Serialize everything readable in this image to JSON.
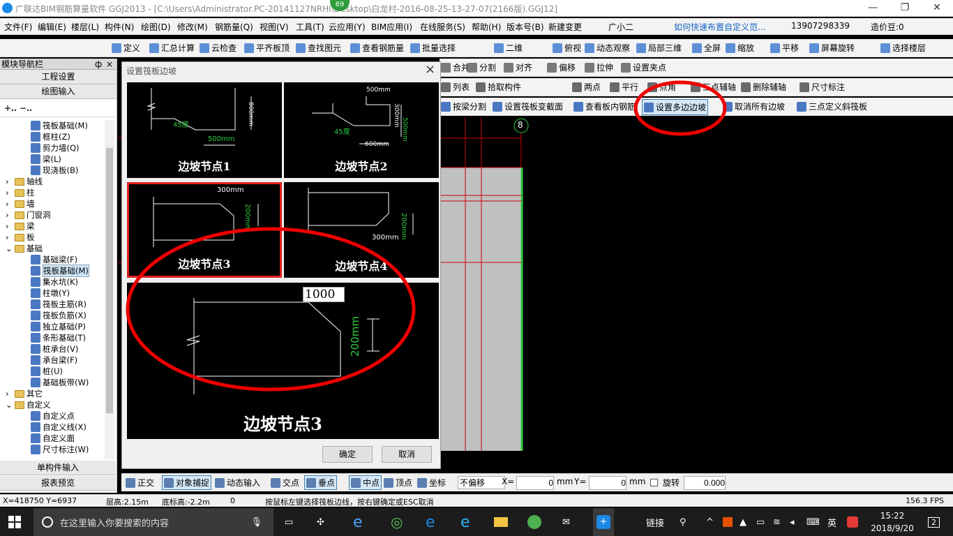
{
  "window": {
    "title": "广联达BIM钢筋算量软件 GGJ2013 - [C:\\Users\\Administrator.PC-20141127NRHI\\Desktop\\白龙村-2016-08-25-13-27-07(2166版).GGJ12]",
    "badge": "69"
  },
  "menu": [
    "文件(F)",
    "编辑(E)",
    "楼层(L)",
    "构件(N)",
    "绘图(D)",
    "修改(M)",
    "钢筋量(Q)",
    "视图(V)",
    "工具(T)",
    "云应用(Y)",
    "BIM应用(I)",
    "在线服务(S)",
    "帮助(H)",
    "版本号(B)",
    "新建变更",
    "广小二",
    "如何快速布置自定义范...",
    "13907298339",
    "造价豆:0"
  ],
  "toolbar1": [
    "定义",
    "汇总计算",
    "云检查",
    "平齐板顶",
    "查找图元",
    "查看钢筋量",
    "批量选择",
    "二维",
    "俯视",
    "动态观察",
    "局部三维",
    "全屏",
    "缩放",
    "平移",
    "屏幕旋转",
    "选择楼层"
  ],
  "toolbar2": [
    "合并",
    "分割",
    "对齐",
    "偏移",
    "拉伸",
    "设置夹点"
  ],
  "toolbar3": [
    "列表",
    "拾取构件",
    "两点",
    "平行",
    "点角",
    "三点辅轴",
    "删除辅轴",
    "尺寸标注"
  ],
  "toolbar4": [
    "按梁分割",
    "设置筏板变截面",
    "查看板内钢筋",
    "设置多边边坡",
    "取消所有边坡",
    "三点定义斜筏板"
  ],
  "nav": {
    "title": "模块导航栏",
    "pin": "ф",
    "close": "×",
    "buttons": [
      "工程设置",
      "绘图输入"
    ],
    "tree": [
      {
        "label": "筏板基础(M)",
        "indent": 2,
        "icon": "item"
      },
      {
        "label": "框柱(Z)",
        "indent": 2,
        "icon": "item"
      },
      {
        "label": "剪力墙(Q)",
        "indent": 2,
        "icon": "item"
      },
      {
        "label": "梁(L)",
        "indent": 2,
        "icon": "item"
      },
      {
        "label": "现浇板(B)",
        "indent": 2,
        "icon": "item"
      },
      {
        "label": "轴线",
        "indent": 1,
        "icon": "folder"
      },
      {
        "label": "柱",
        "indent": 1,
        "icon": "folder"
      },
      {
        "label": "墙",
        "indent": 1,
        "icon": "folder"
      },
      {
        "label": "门窗洞",
        "indent": 1,
        "icon": "folder"
      },
      {
        "label": "梁",
        "indent": 1,
        "icon": "folder"
      },
      {
        "label": "板",
        "indent": 1,
        "icon": "folder"
      },
      {
        "label": "基础",
        "indent": 1,
        "icon": "folder-open"
      },
      {
        "label": "基础梁(F)",
        "indent": 2,
        "icon": "item"
      },
      {
        "label": "筏板基础(M)",
        "indent": 2,
        "icon": "item",
        "selected": true
      },
      {
        "label": "集水坑(K)",
        "indent": 2,
        "icon": "item"
      },
      {
        "label": "柱墩(Y)",
        "indent": 2,
        "icon": "item"
      },
      {
        "label": "筏板主筋(R)",
        "indent": 2,
        "icon": "item"
      },
      {
        "label": "筏板负筋(X)",
        "indent": 2,
        "icon": "item"
      },
      {
        "label": "独立基础(P)",
        "indent": 2,
        "icon": "item"
      },
      {
        "label": "条形基础(T)",
        "indent": 2,
        "icon": "item"
      },
      {
        "label": "桩承台(V)",
        "indent": 2,
        "icon": "item"
      },
      {
        "label": "承台梁(F)",
        "indent": 2,
        "icon": "item"
      },
      {
        "label": "桩(U)",
        "indent": 2,
        "icon": "item"
      },
      {
        "label": "基础板带(W)",
        "indent": 2,
        "icon": "item"
      },
      {
        "label": "其它",
        "indent": 1,
        "icon": "folder"
      },
      {
        "label": "自定义",
        "indent": 1,
        "icon": "folder-open"
      },
      {
        "label": "自定义点",
        "indent": 2,
        "icon": "item"
      },
      {
        "label": "自定义线(X)",
        "indent": 2,
        "icon": "item"
      },
      {
        "label": "自定义面",
        "indent": 2,
        "icon": "item"
      },
      {
        "label": "尺寸标注(W)",
        "indent": 2,
        "icon": "item"
      }
    ],
    "bottom": [
      "单构件输入",
      "报表预览"
    ]
  },
  "dialog": {
    "title": "设置筏板边坡",
    "close": "×",
    "nodes": [
      {
        "caption": "边坡节点1",
        "labels": [
          "45度",
          "800mm",
          "500mm"
        ]
      },
      {
        "caption": "边坡节点2",
        "labels": [
          "500mm",
          "300mm",
          "500mm",
          "45度",
          "600mm"
        ]
      },
      {
        "caption": "边坡节点3",
        "labels": [
          "300mm",
          "200mm"
        ]
      },
      {
        "caption": "边坡节点4",
        "labels": [
          "200mm",
          "300mm"
        ]
      }
    ],
    "preview": {
      "caption": "边坡节点3",
      "width_value": "1000",
      "height_label": "200mm"
    },
    "ok": "确定",
    "cancel": "取消"
  },
  "canvas": {
    "axis_label": "8"
  },
  "snapbar": {
    "items": [
      "正交",
      "对象捕捉",
      "动态输入",
      "交点",
      "垂点",
      "中点",
      "顶点",
      "坐标"
    ],
    "offset_mode": "不偏移",
    "x_label": "X=",
    "x_value": "0",
    "y_label": "Y=",
    "y_value": "0",
    "unit": "mm",
    "rotate_label": "旋转",
    "rotate_value": "0.000"
  },
  "status": {
    "coords": "X=418750 Y=6937",
    "floor_height": "层高:2.15m",
    "base_height": "底标高:-2.2m",
    "zero": "0",
    "hint": "按鼠标左键选择筏板边线，按右键确定或ESC取消",
    "fps": "156.3 FPS"
  },
  "taskbar": {
    "search_placeholder": "在这里输入你要搜索的内容",
    "link": "链接",
    "ime": "英",
    "time": "15:22",
    "date": "2018/9/20",
    "notif": "2"
  }
}
